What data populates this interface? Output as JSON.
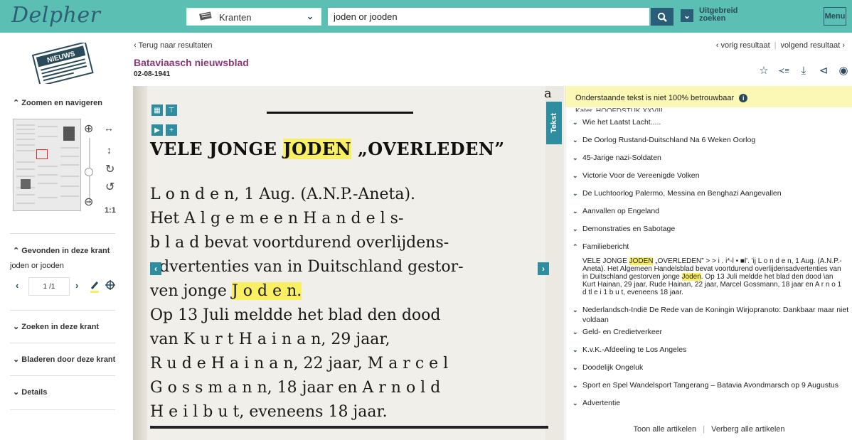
{
  "header": {
    "logo_text": "Delpher",
    "collection": "Kranten",
    "search_value": "joden or jooden",
    "advanced_label": "Uitgebreid zoeken",
    "menu_label": "Menu"
  },
  "sidebar": {
    "zoom_title": "Zoomen en navigeren",
    "zoom_ratio": "1:1",
    "found_title": "Gevonden in deze krant",
    "found_query": "joden or jooden",
    "pager_current": "1",
    "pager_total": "/1",
    "search_in_title": "Zoeken in deze krant",
    "browse_title": "Bladeren door deze krant",
    "details_title": "Details"
  },
  "document": {
    "back_link": "Terug naar resultaten",
    "title": "Bataviaasch nieuwsblad",
    "date": "02-08-1941",
    "prev_result": "vorig resultaat",
    "next_result": "volgend resultaat",
    "tekst_tab": "Tekst"
  },
  "scan": {
    "corner_letter": "a",
    "headline_before": "VELE JONGE ",
    "headline_highlight": "JODEN",
    "headline_after": " „OVERLEDEN”",
    "lines": [
      "L o n d e n,  1 Aug.  (A.N.P.-Aneta).",
      "Het  A l g e m e e n  H a n d e l s-",
      "b l a d  bevat voortdurend overlijdens-",
      "advertenties van in Duitschland gestor-"
    ],
    "line5_before": "ven jonge  ",
    "line5_highlight": "J o d e n.",
    "lines_after": [
      "  Op 13 Juli meldde het blad den dood",
      "van  K u r t  H a i n a n,  29 jaar,",
      "R u d e  H a i n a n,  22 jaar, M a r c e l",
      "G o s s m a n n,  18 jaar en  A r n o l d",
      "H e i l b u t,  eveneens 18 jaar."
    ]
  },
  "text_panel": {
    "warning": "Onderstaande tekst is niet 100% betrouwbaar",
    "cut_line": "Kater, HOOFDSTUK XXVIII",
    "articles_before": [
      "Wie het Laatst Lacht.....",
      "De Oorlog Rustand-Duitschland Na 6 Weken Oorlog",
      "45-Jarige nazi-Soldaten",
      "Victorie Voor de Vereenigde Volken",
      "De Luchtoorlog Palermo, Messina en Benghazi Aangevallen",
      "Aanvallen op Engeland",
      "Demonstraties en Sabotage"
    ],
    "expanded_title": "Familiebericht",
    "expanded_text_before": "VELE JONGE ",
    "expanded_highlight_1": "JODEN",
    "expanded_text_middle": " „OVERLEDEN” > > i . i*-l • ■l'. 'ij L o n d e n, 1 Aug. (A.N.P.-Aneta). Het Algemeen Handelsblad bevat voortdurend overlijdensadvertenties van in Duitschland gestorven jonge ",
    "expanded_highlight_2": "Joden",
    "expanded_text_after": ". Op 13 Juli meldde het blad den dood \\an Kurt Hainan, 29 jaar, Rude Hainan, 22 jaar, Marcel Gossmann, 18 jaar en A r n o 1 d tl e i 1 b u t, eveneens 18 jaar.",
    "articles_after": [
      "Nederlandsch-Indië De Rede van de Koningin Wirjopranoto: Dankbaar maar niet voldaan",
      "Geld- en Credietverkeer",
      "K.v.K.-Afdeeling te Los Angeles",
      "Doodelijk Ongeluk",
      "Sport en Spel Wandelsport Tangerang – Batavia Avondmarsch op 9 Augustus",
      "Advertentie"
    ],
    "show_all": "Toon alle artikelen",
    "hide_all": "Verberg alle artikelen"
  },
  "colors": {
    "header_bg": "#5bbfb4",
    "accent_dark": "#2a5e78",
    "title_color": "#8a3a78",
    "highlight": "#f9ef62",
    "warning_bg": "#fbf7b4"
  }
}
